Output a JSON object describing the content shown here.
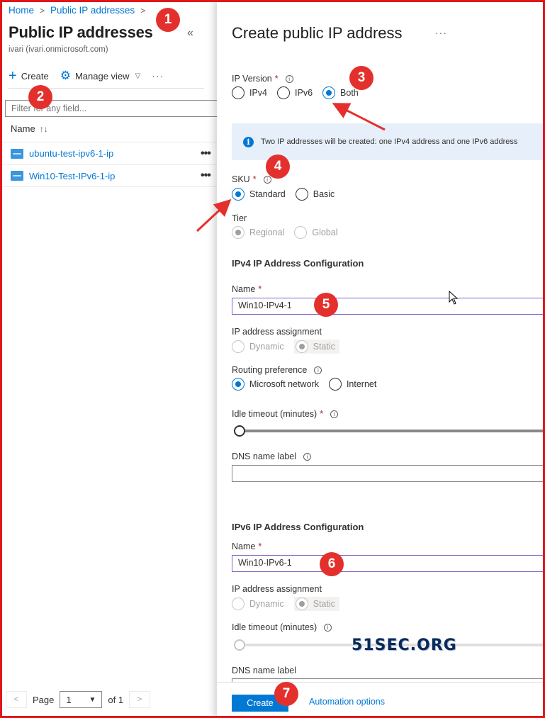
{
  "breadcrumb": {
    "home": "Home",
    "current": "Public IP addresses"
  },
  "left": {
    "title": "Public IP addresses",
    "tenant": "ivari (ivari.onmicrosoft.com)",
    "toolbar": {
      "create": "Create",
      "manage_view": "Manage view"
    },
    "filter_placeholder": "Filter for any field...",
    "column_name": "Name",
    "rows": [
      {
        "name": "ubuntu-test-ipv6-1-ip"
      },
      {
        "name": "Win10-Test-IPv6-1-ip"
      }
    ],
    "pager": {
      "page_label": "Page",
      "page_value": "1",
      "of_label": "of 1"
    }
  },
  "form": {
    "title": "Create public IP address",
    "ip_version": {
      "label": "IP Version",
      "options": [
        "IPv4",
        "IPv6",
        "Both"
      ],
      "selected": "Both"
    },
    "info_message": "Two IP addresses will be created: one IPv4 address and one IPv6 address",
    "sku": {
      "label": "SKU",
      "options": [
        "Standard",
        "Basic"
      ],
      "selected": "Standard"
    },
    "tier": {
      "label": "Tier",
      "options": [
        "Regional",
        "Global"
      ],
      "selected": "Regional"
    },
    "ipv4": {
      "section": "IPv4 IP Address Configuration",
      "name_label": "Name",
      "name_value": "Win10-IPv4-1",
      "assignment_label": "IP address assignment",
      "assignment_options": [
        "Dynamic",
        "Static"
      ],
      "assignment_selected": "Static",
      "routing_label": "Routing preference",
      "routing_options": [
        "Microsoft network",
        "Internet"
      ],
      "routing_selected": "Microsoft network",
      "idle_label": "Idle timeout (minutes)",
      "dns_label": "DNS name label"
    },
    "ipv6": {
      "section": "IPv6 IP Address Configuration",
      "name_label": "Name",
      "name_value": "Win10-IPv6-1",
      "assignment_label": "IP address assignment",
      "assignment_options": [
        "Dynamic",
        "Static"
      ],
      "assignment_selected": "Static",
      "idle_label": "Idle timeout (minutes)",
      "dns_label": "DNS name label"
    },
    "footer": {
      "create": "Create",
      "automation": "Automation options"
    }
  },
  "watermark": "51SEC.ORG",
  "annotations": [
    "1",
    "2",
    "3",
    "4",
    "5",
    "6",
    "7"
  ],
  "colors": {
    "accent": "#0078d4",
    "annotation": "#e4302d",
    "frame": "#e0161b"
  }
}
